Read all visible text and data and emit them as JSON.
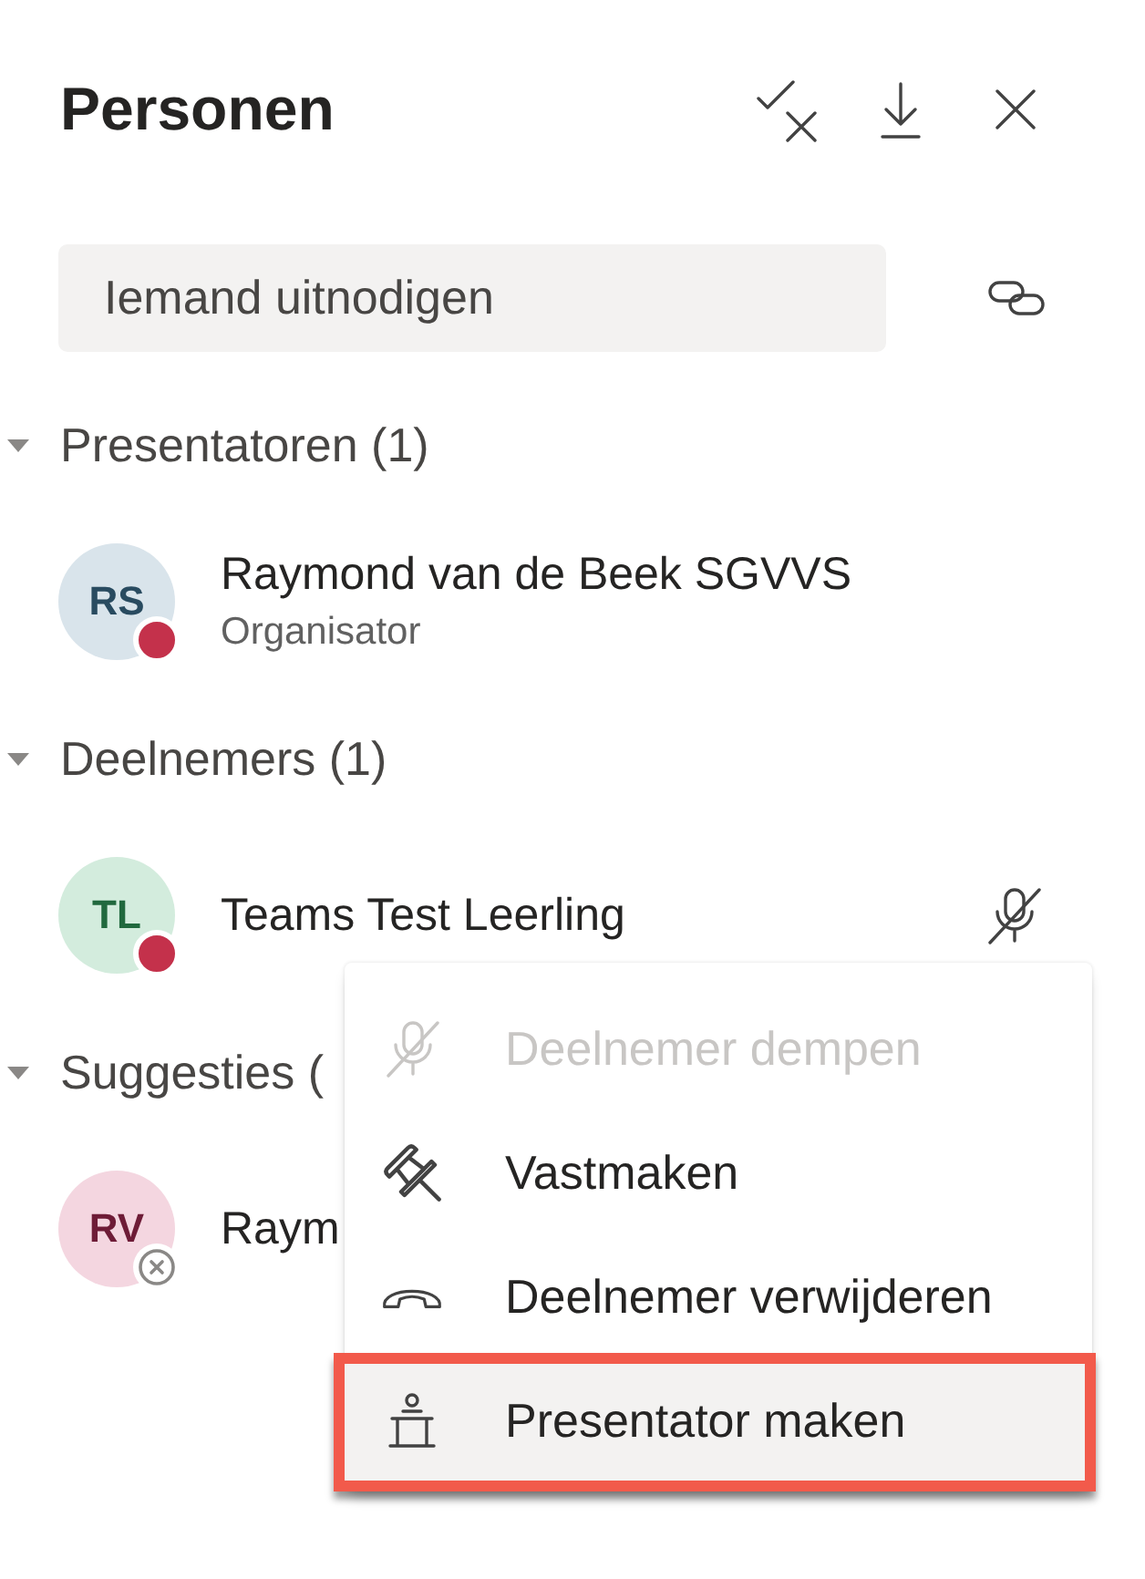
{
  "panel": {
    "title": "Personen"
  },
  "invite": {
    "placeholder": "Iemand uitnodigen"
  },
  "sections": [
    {
      "title": "Presentatoren (1)",
      "expanded": true,
      "people": [
        {
          "initials": "RS",
          "name": "Raymond van de Beek SGVVS",
          "role": "Organisator",
          "color": "#d9e4eb",
          "kind": "busy",
          "muted": false
        }
      ]
    },
    {
      "title": "Deelnemers (1)",
      "expanded": true,
      "people": [
        {
          "initials": "TL",
          "name": "Teams Test Leerling",
          "color": "#d3ecdd",
          "kind": "busy",
          "muted": true
        }
      ]
    },
    {
      "title": "Suggesties (",
      "expanded": true,
      "people": [
        {
          "initials": "RV",
          "name": "Raym",
          "color": "#f4d6e0",
          "kind": "offline",
          "muted": false
        }
      ]
    }
  ],
  "context_menu": {
    "items": [
      {
        "label": "Deelnemer dempen",
        "disabled": true,
        "selected": false,
        "highlighted": false
      },
      {
        "label": "Vastmaken",
        "disabled": false,
        "selected": false,
        "highlighted": false
      },
      {
        "label": "Deelnemer verwijderen",
        "disabled": false,
        "selected": false,
        "highlighted": false
      },
      {
        "label": "Presentator maken",
        "disabled": false,
        "selected": true,
        "highlighted": true
      }
    ]
  }
}
